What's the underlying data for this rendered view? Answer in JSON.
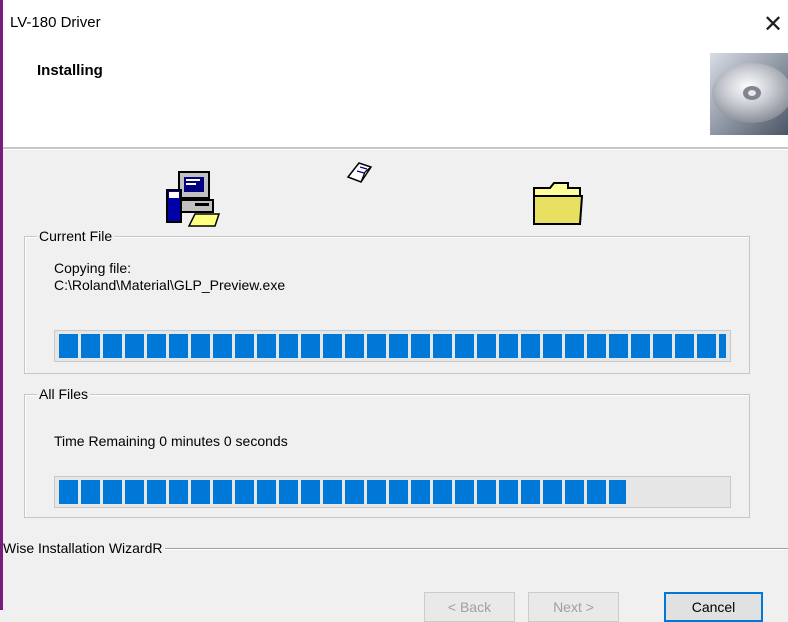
{
  "window": {
    "title": "LV-180 Driver",
    "close_glyph": "✕"
  },
  "header": {
    "title": "Installing",
    "icon": "cd-disc-icon"
  },
  "animation_icons": [
    "computer-install-icon",
    "flying-paper-icon",
    "folder-icon"
  ],
  "current_file": {
    "legend": "Current File",
    "line1": "Copying file:",
    "path": "C:\\Roland\\Material\\GLP_Preview.exe",
    "progress": 1.0
  },
  "all_files": {
    "legend": "All Files",
    "time_remaining": "Time Remaining 0 minutes 0 seconds",
    "progress": 0.85
  },
  "footer": {
    "wizard_label": "Wise Installation WizardR"
  },
  "buttons": {
    "back": "< Back",
    "next": "Next >",
    "cancel": "Cancel"
  },
  "colors": {
    "progress": "#0078d7",
    "window_border": "#7a1c7a"
  }
}
